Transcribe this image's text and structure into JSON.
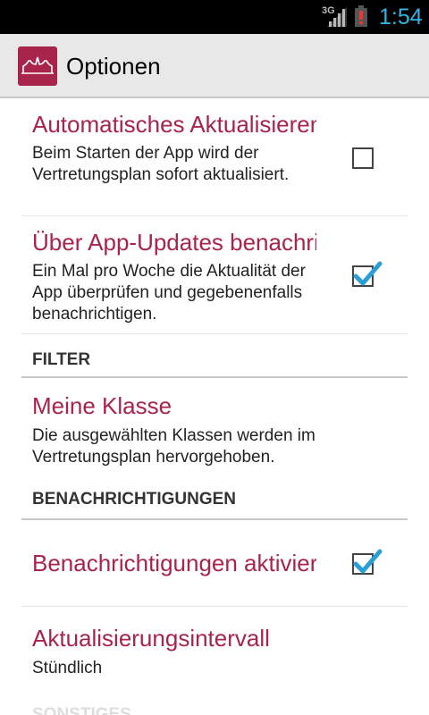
{
  "status_bar": {
    "network": "3G",
    "time": "1:54",
    "accent_color": "#33b5e5",
    "battery_warning_color": "#e53935"
  },
  "action_bar": {
    "title": "Optionen",
    "icon": "app-logo-icon",
    "brand_color": "#a8244b"
  },
  "preferences": [
    {
      "title": "Automatisches Aktualisieren",
      "summary": "Beim Starten der App wird der Vertretungsplan sofort aktualisiert.",
      "checked": false
    },
    {
      "title": "Über App-Updates benachrichtigen",
      "summary": "Ein Mal pro Woche die Aktualität der App überprüfen und gegebenenfalls benachrichtigen.",
      "checked": true
    }
  ],
  "filter": {
    "category": "FILTER",
    "my_class": {
      "title": "Meine Klasse",
      "summary": "Die ausgewählten Klassen werden im Vertretungsplan hervorgehoben."
    }
  },
  "notifications": {
    "category": "BENACHRICHTIGUNGEN",
    "enable": {
      "title": "Benachrichtigungen aktivieren",
      "checked": true
    },
    "interval": {
      "title": "Aktualisierungsintervall",
      "summary": "Stündlich"
    }
  },
  "other": {
    "category": "SONSTIGES"
  }
}
